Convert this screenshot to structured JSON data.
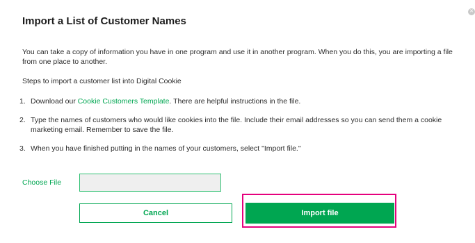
{
  "dialog": {
    "title": "Import a List of Customer Names",
    "close_icon": "close-icon",
    "intro": "You can take a copy of information you have in one program and use it in another program. When you do this, you are importing a file from one place to another.",
    "steps_heading": "Steps to import a customer list into Digital Cookie",
    "steps": [
      {
        "number": "1.",
        "prefix": "Download our ",
        "link": "Cookie Customers Template",
        "suffix": ". There are helpful instructions in the file."
      },
      {
        "number": "2.",
        "text": "Type the names of customers who would like cookies into the file. Include their email addresses so you can send them a cookie marketing email. Remember to save the file."
      },
      {
        "number": "3.",
        "text": "When you have finished putting in the names of your customers, select \"Import file.\""
      }
    ],
    "choose_file_label": "Choose File",
    "file_value": "",
    "cancel_label": "Cancel",
    "import_label": "Import file"
  },
  "colors": {
    "accent_green": "#00a651",
    "highlight": "#e5007d"
  }
}
